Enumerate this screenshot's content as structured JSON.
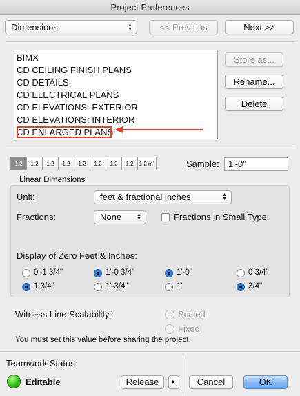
{
  "window": {
    "title": "Project Preferences"
  },
  "nav": {
    "category_select": "Dimensions",
    "previous_label": "<< Previous",
    "next_label": "Next >>"
  },
  "list": {
    "items": [
      "BIMX",
      "CD CEILING FINISH PLANS",
      "CD DETAILS",
      "CD ELECTRICAL PLANS",
      "CD ELEVATIONS: EXTERIOR",
      "CD ELEVATIONS: INTERIOR",
      "CD ENLARGED PLANS"
    ],
    "store_as_label": "Store as...",
    "rename_label": "Rename...",
    "delete_label": "Delete",
    "annotation_color": "#e8402a"
  },
  "dimension_tools": {
    "labels": [
      "1.2",
      "1.2",
      "1.2",
      "1.2",
      "1.2",
      "1.2",
      "1.2",
      "1.2",
      "1.2 m²"
    ]
  },
  "sample": {
    "label": "Sample:",
    "value": "1'-0\""
  },
  "linear": {
    "section_title": "Linear Dimensions",
    "unit_label": "Unit:",
    "unit_value": "feet & fractional inches",
    "fractions_label": "Fractions:",
    "fractions_value": "None",
    "small_type_label": "Fractions in Small Type",
    "zero_label": "Display of Zero Feet & Inches:",
    "options": [
      {
        "text": "0'-1 3/4\"",
        "selected": false
      },
      {
        "text": "1'-0 3/4\"",
        "selected": true
      },
      {
        "text": "1'-0\"",
        "selected": true
      },
      {
        "text": "0 3/4\"",
        "selected": false
      },
      {
        "text": "1 3/4\"",
        "selected": true
      },
      {
        "text": "1'-3/4\"",
        "selected": false
      },
      {
        "text": "1'",
        "selected": false
      },
      {
        "text": "3/4\"",
        "selected": true
      }
    ]
  },
  "witness": {
    "label": "Witness Line Scalability:",
    "scaled": "Scaled",
    "fixed": "Fixed",
    "note": "You must set this value before sharing the project."
  },
  "footer": {
    "teamwork_label": "Teamwork Status:",
    "status": "Editable",
    "release_label": "Release",
    "more_label": "▸",
    "cancel_label": "Cancel",
    "ok_label": "OK"
  }
}
